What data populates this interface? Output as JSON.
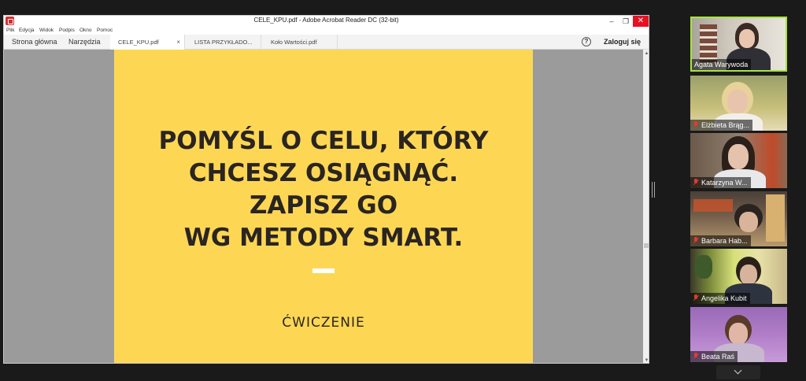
{
  "acrobat": {
    "window_title": "CELE_KPU.pdf - Adobe Acrobat Reader DC (32-bit)",
    "menu": [
      "Plik",
      "Edycja",
      "Widok",
      "Podpis",
      "Okno",
      "Pomoc"
    ],
    "nav": {
      "home": "Strona główna",
      "tools": "Narzędzia"
    },
    "tabs": [
      {
        "label": "CELE_KPU.pdf",
        "active": true
      },
      {
        "label": "LISTA PRZYKŁADO..."
      },
      {
        "label": "Koło Wartości.pdf"
      }
    ],
    "tab_close": "×",
    "help": "?",
    "login": "Zaloguj się",
    "window_buttons": {
      "minimize": "–",
      "maximize": "❐",
      "close": "✕"
    },
    "scroll": {
      "up": "▲",
      "down": "▼"
    }
  },
  "slide": {
    "title": "POMYŚL O CELU, KTÓRY\nCHCESZ OSIĄGNĄĆ.\nZAPISZ GO\nWG METODY SMART.",
    "label": "ĆWICZENIE",
    "background": "#fdd754",
    "text_color": "#2a2422"
  },
  "participants": [
    {
      "name": "Agata Warywoda",
      "muted": false,
      "active_speaker": true
    },
    {
      "name": "Elżbieta Brąg...",
      "muted": true
    },
    {
      "name": "Katarzyna W...",
      "muted": true
    },
    {
      "name": "Barbara Hab...",
      "muted": true
    },
    {
      "name": "Angelika Kubit",
      "muted": true
    },
    {
      "name": "Beata Raś",
      "muted": true
    }
  ],
  "colors": {
    "active_speaker_border": "#a8e33e",
    "muted_icon": "#e53935",
    "close_button": "#e81123"
  }
}
